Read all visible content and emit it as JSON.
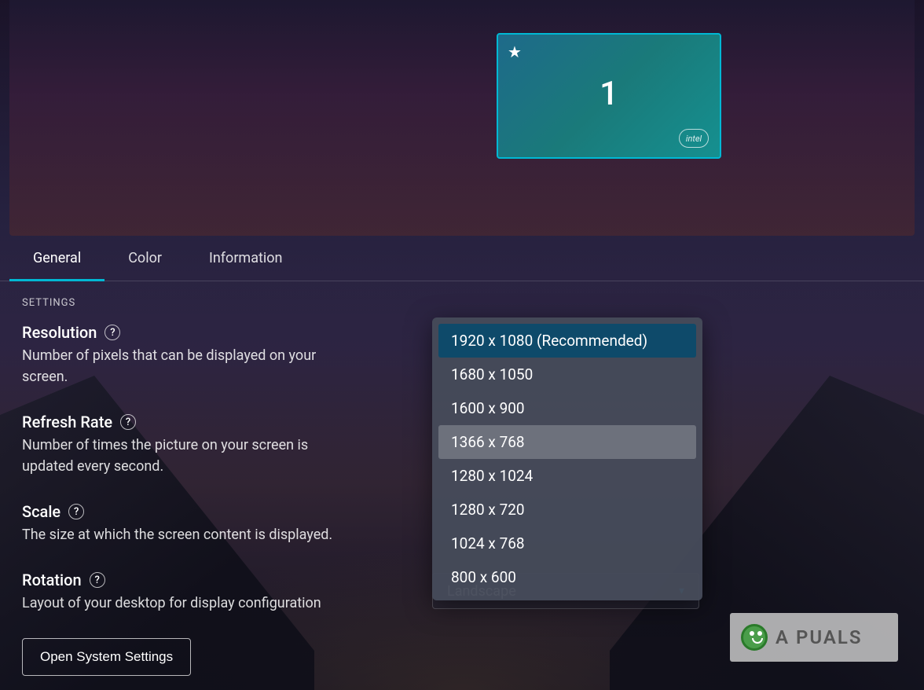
{
  "display": {
    "number": "1",
    "intel_label": "intel"
  },
  "tabs": [
    {
      "label": "General",
      "active": true
    },
    {
      "label": "Color",
      "active": false
    },
    {
      "label": "Information",
      "active": false
    }
  ],
  "settings_header": "SETTINGS",
  "settings": {
    "resolution": {
      "title": "Resolution",
      "description": "Number of pixels that can be displayed on your screen."
    },
    "refresh_rate": {
      "title": "Refresh Rate",
      "description": "Number of times the picture on your screen is updated every second."
    },
    "scale": {
      "title": "Scale",
      "description": "The size at which the screen content is displayed."
    },
    "rotation": {
      "title": "Rotation",
      "description": "Layout of your desktop for display configuration",
      "value": "Landscape"
    }
  },
  "resolution_dropdown": {
    "options": [
      {
        "label": "1920 x 1080 (Recommended)",
        "selected": true,
        "hovered": false
      },
      {
        "label": "1680 x 1050",
        "selected": false,
        "hovered": false
      },
      {
        "label": "1600 x 900",
        "selected": false,
        "hovered": false
      },
      {
        "label": "1366 x 768",
        "selected": false,
        "hovered": true
      },
      {
        "label": "1280 x 1024",
        "selected": false,
        "hovered": false
      },
      {
        "label": "1280 x 720",
        "selected": false,
        "hovered": false
      },
      {
        "label": "1024 x 768",
        "selected": false,
        "hovered": false
      },
      {
        "label": "800 x 600",
        "selected": false,
        "hovered": false
      }
    ]
  },
  "system_settings_button": "Open System Settings",
  "watermark": "A   PUALS"
}
